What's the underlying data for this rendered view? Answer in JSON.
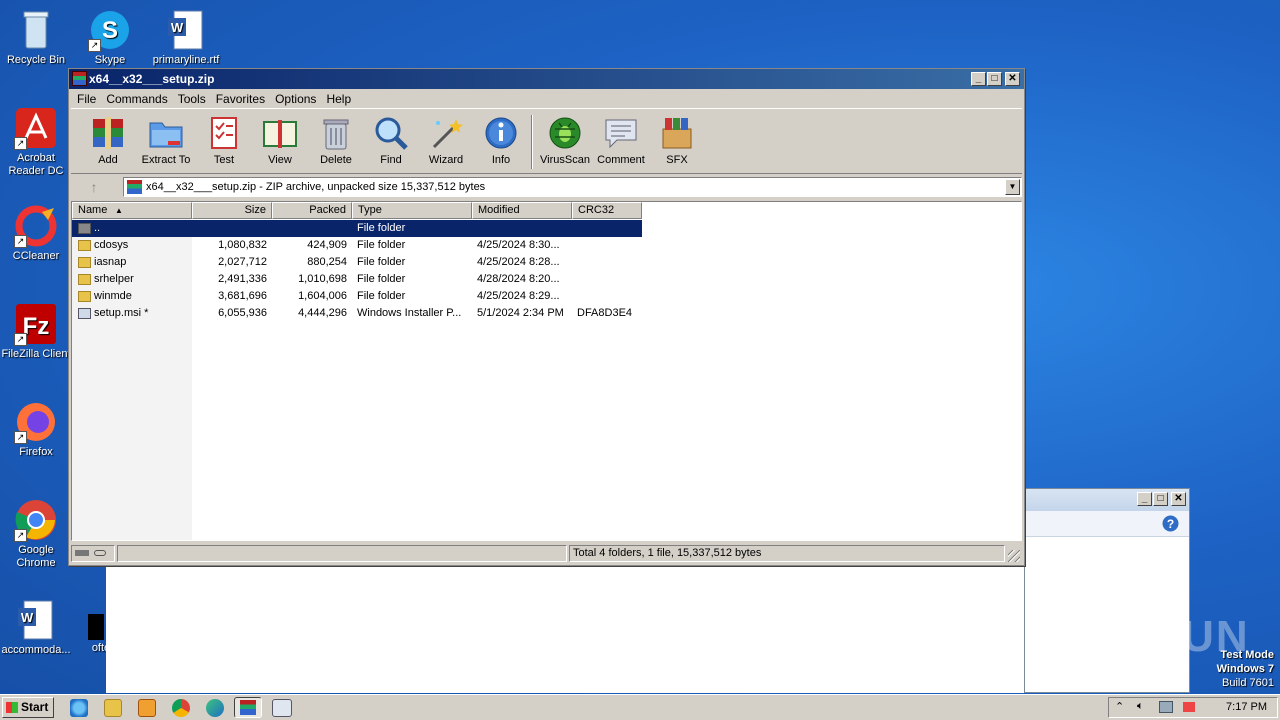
{
  "desktop": {
    "icons": [
      {
        "label": "Recycle Bin",
        "icon": "recycle-bin-icon"
      },
      {
        "label": "Skype",
        "icon": "skype-icon"
      },
      {
        "label": "primaryline.rtf",
        "icon": "word-document-icon"
      },
      {
        "label": "Acrobat Reader DC",
        "icon": "acrobat-icon"
      },
      {
        "label": "CCleaner",
        "icon": "ccleaner-icon"
      },
      {
        "label": "FileZilla Client",
        "icon": "filezilla-icon"
      },
      {
        "label": "Firefox",
        "icon": "firefox-icon"
      },
      {
        "label": "Google Chrome",
        "icon": "chrome-icon"
      },
      {
        "label": "accommoda...",
        "icon": "word-document-icon"
      },
      {
        "label": "ofte",
        "icon": "file-icon"
      }
    ],
    "watermark": "ANY RUN",
    "testmode": [
      "Test Mode",
      "Windows 7",
      "Build 7601"
    ]
  },
  "window": {
    "title": "x64__x32___setup.zip",
    "controls": {
      "minimize": "_",
      "maximize": "□",
      "close": "✕"
    },
    "menu": [
      "File",
      "Commands",
      "Tools",
      "Favorites",
      "Options",
      "Help"
    ],
    "toolbar": [
      {
        "label": "Add",
        "icon": "add-archive-icon"
      },
      {
        "label": "Extract To",
        "icon": "extract-folder-icon"
      },
      {
        "label": "Test",
        "icon": "test-checklist-icon"
      },
      {
        "label": "View",
        "icon": "view-book-icon"
      },
      {
        "label": "Delete",
        "icon": "delete-trash-icon"
      },
      {
        "label": "Find",
        "icon": "find-magnifier-icon"
      },
      {
        "label": "Wizard",
        "icon": "wizard-wand-icon"
      },
      {
        "label": "Info",
        "icon": "info-icon"
      },
      {
        "label": "VirusScan",
        "icon": "virusscan-bug-icon"
      },
      {
        "label": "Comment",
        "icon": "comment-icon"
      },
      {
        "label": "SFX",
        "icon": "sfx-box-icon"
      }
    ],
    "address": "x64__x32___setup.zip - ZIP archive, unpacked size 15,337,512 bytes",
    "columns": [
      "Name",
      "Size",
      "Packed",
      "Type",
      "Modified",
      "CRC32"
    ],
    "rows": [
      {
        "name": "..",
        "size": "",
        "packed": "",
        "type": "File folder",
        "modified": "",
        "crc": "",
        "kind": "up"
      },
      {
        "name": "cdosys",
        "size": "1,080,832",
        "packed": "424,909",
        "type": "File folder",
        "modified": "4/25/2024 8:30...",
        "crc": "",
        "kind": "folder"
      },
      {
        "name": "iasnap",
        "size": "2,027,712",
        "packed": "880,254",
        "type": "File folder",
        "modified": "4/25/2024 8:28...",
        "crc": "",
        "kind": "folder"
      },
      {
        "name": "srhelper",
        "size": "2,491,336",
        "packed": "1,010,698",
        "type": "File folder",
        "modified": "4/28/2024 8:20...",
        "crc": "",
        "kind": "folder"
      },
      {
        "name": "winmde",
        "size": "3,681,696",
        "packed": "1,604,006",
        "type": "File folder",
        "modified": "4/25/2024 8:29...",
        "crc": "",
        "kind": "folder"
      },
      {
        "name": "setup.msi *",
        "size": "6,055,936",
        "packed": "4,444,296",
        "type": "Windows Installer P...",
        "modified": "5/1/2024 2:34 PM",
        "crc": "DFA8D3E4",
        "kind": "msi"
      }
    ],
    "status": "Total 4 folders, 1 file, 15,337,512 bytes"
  },
  "taskbar": {
    "start": "Start",
    "clock": "7:17 PM"
  }
}
